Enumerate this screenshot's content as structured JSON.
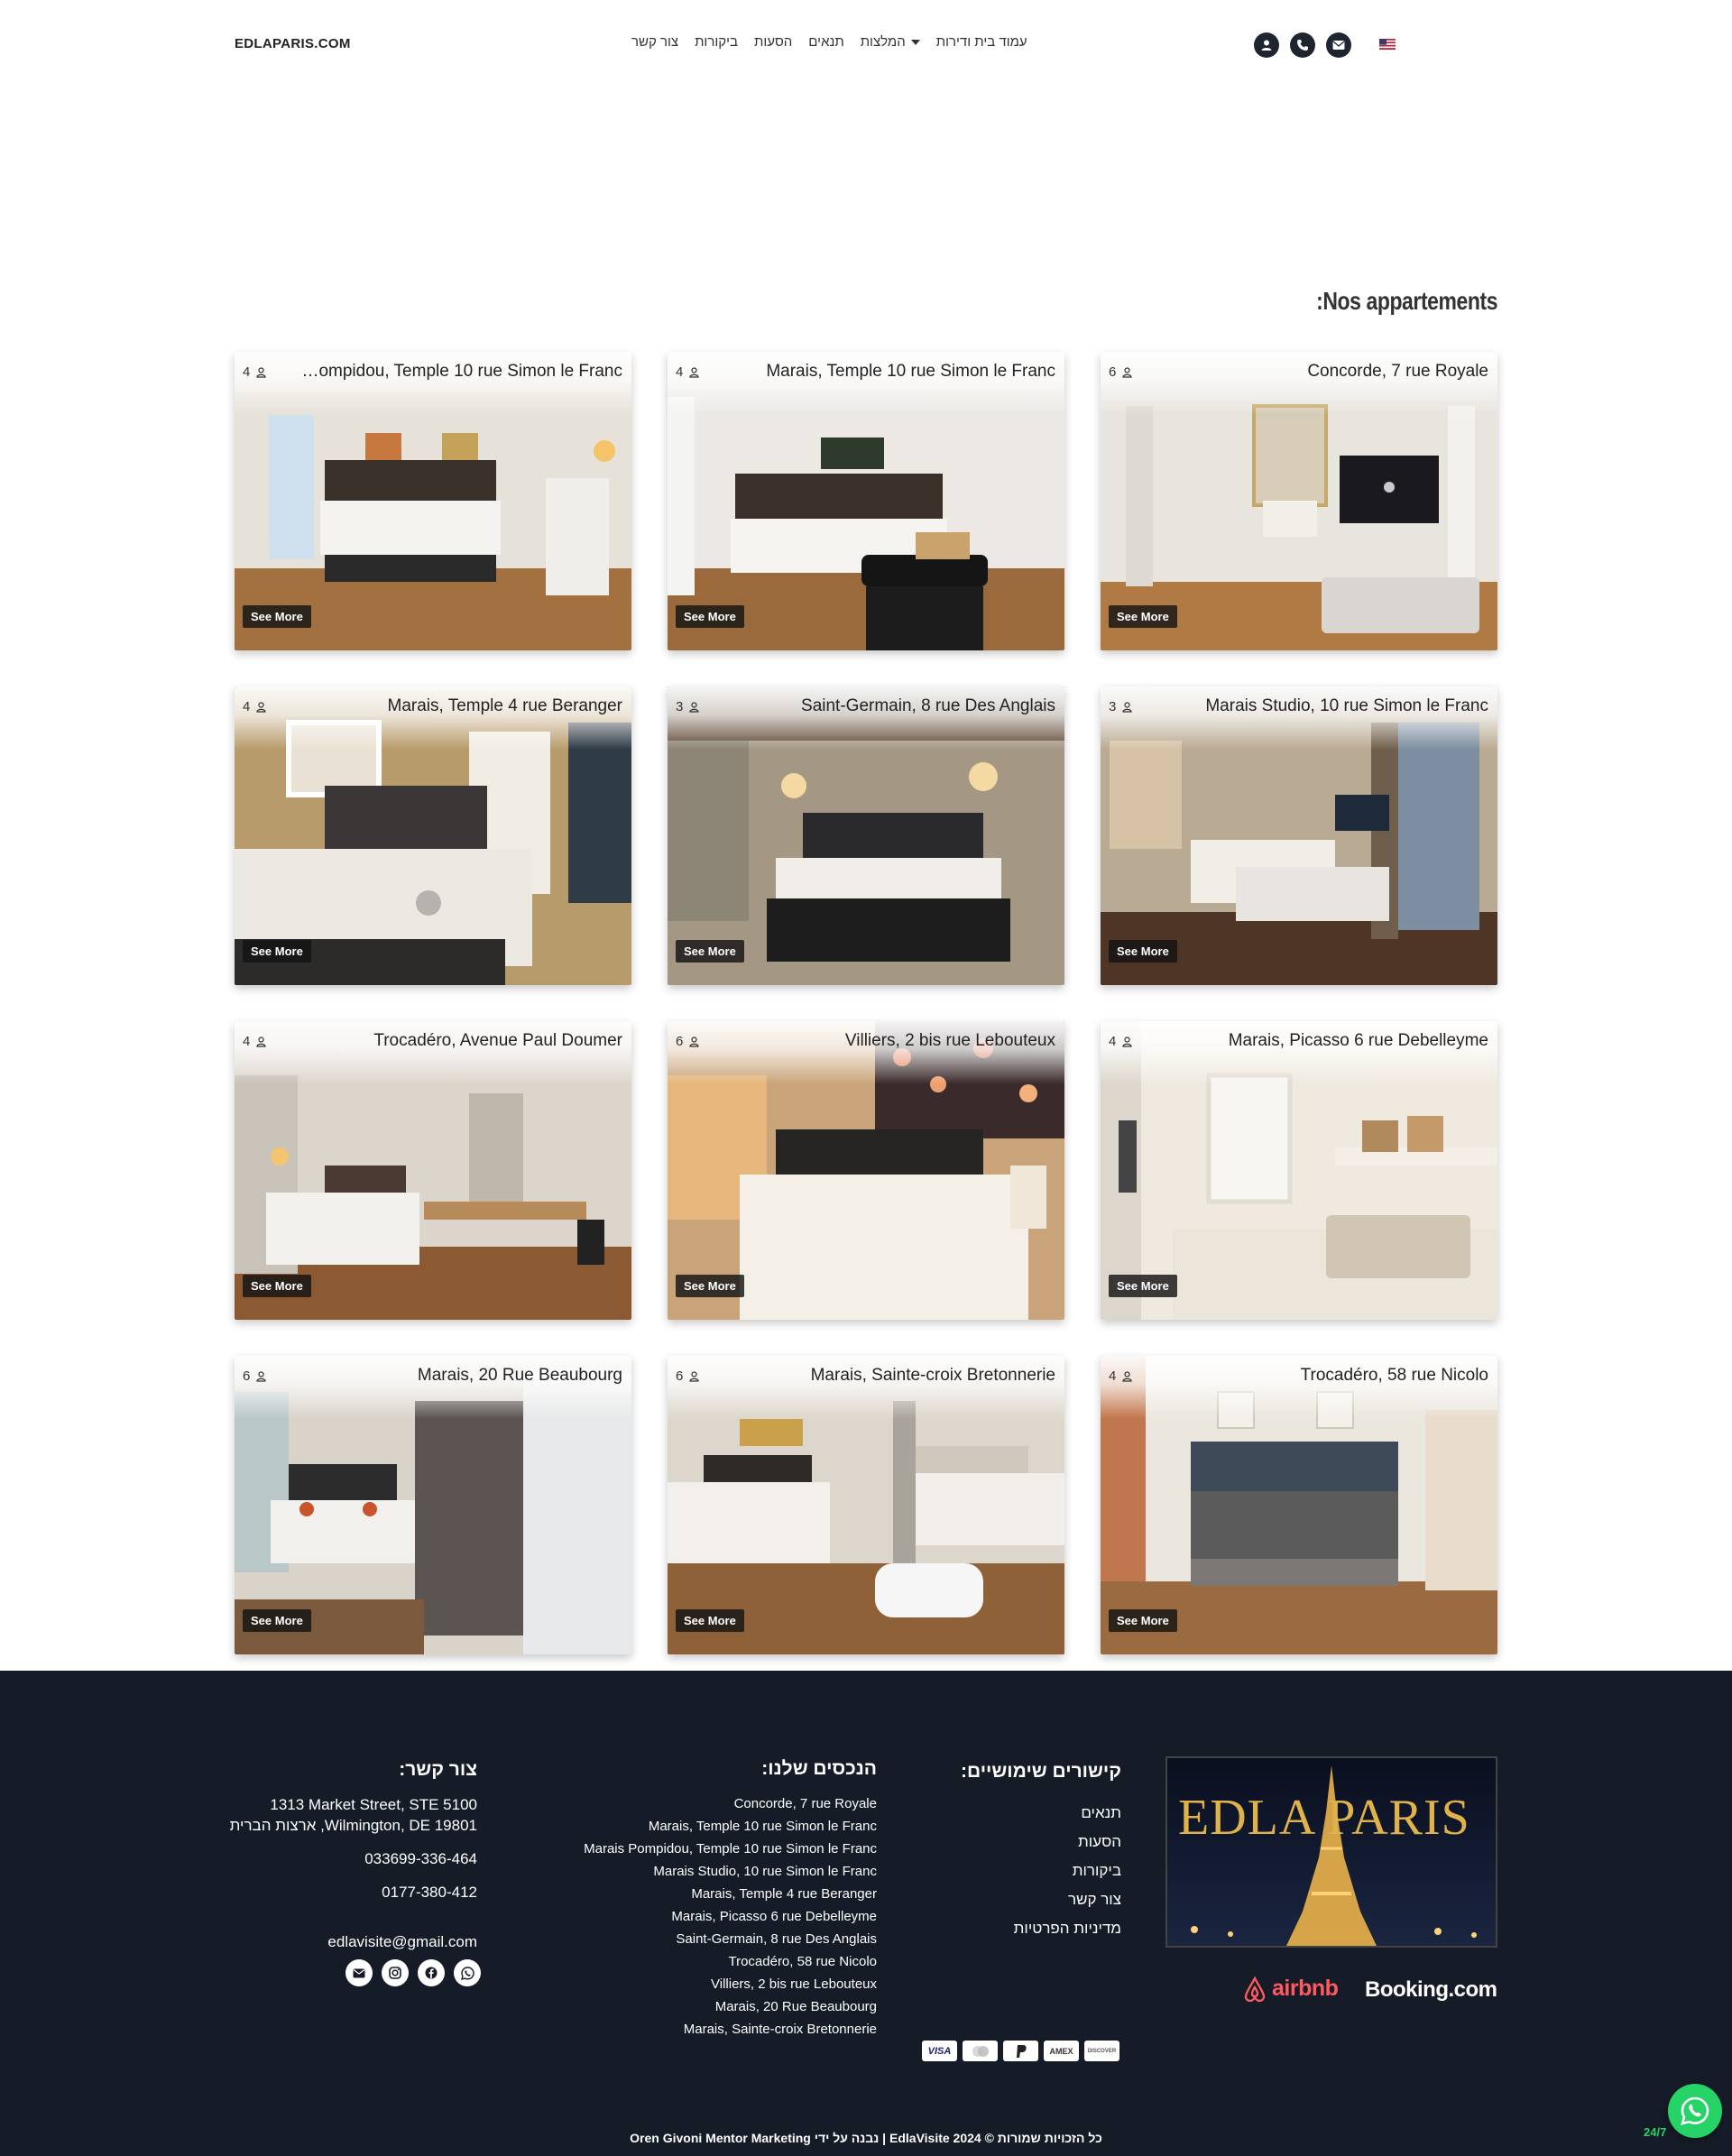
{
  "header": {
    "brand": "EDLAPARIS.COM",
    "nav": [
      {
        "label": "עמוד בית ודירות"
      },
      {
        "label": "המלצות"
      },
      {
        "label": "תנאים"
      },
      {
        "label": "הסעות"
      },
      {
        "label": "ביקורות"
      },
      {
        "label": "צור קשר"
      }
    ],
    "icons": [
      "user-icon",
      "phone-icon",
      "envelope-icon"
    ],
    "language_flag": "us-flag-icon"
  },
  "section": {
    "title": ":Nos appartements"
  },
  "apartments": [
    {
      "title": "Concorde, 7 rue Royale",
      "capacity": "6",
      "button": "See More"
    },
    {
      "title": "Marais, Temple 10 rue Simon le Franc",
      "capacity": "4",
      "button": "See More"
    },
    {
      "title": "Marais Pompidou, Temple 10 rue Simon le Franc",
      "capacity": "4",
      "button": "See More"
    },
    {
      "title": "Marais Studio, 10 rue Simon le Franc",
      "capacity": "3",
      "button": "See More"
    },
    {
      "title": "Saint-Germain, 8 rue Des Anglais",
      "capacity": "3",
      "button": "See More"
    },
    {
      "title": "Marais, Temple 4 rue Beranger",
      "capacity": "4",
      "button": "See More"
    },
    {
      "title": "Marais, Picasso 6 rue Debelleyme",
      "capacity": "4",
      "button": "See More"
    },
    {
      "title": "Villiers, 2 bis rue Lebouteux",
      "capacity": "6",
      "button": "See More"
    },
    {
      "title": "Trocadéro, Avenue Paul Doumer",
      "capacity": "4",
      "button": "See More"
    },
    {
      "title": "Trocadéro, 58 rue Nicolo",
      "capacity": "4",
      "button": "See More"
    },
    {
      "title": "Marais, Sainte-croix Bretonnerie",
      "capacity": "6",
      "button": "See More"
    },
    {
      "title": "Marais, 20 Rue Beaubourg",
      "capacity": "6",
      "button": "See More"
    }
  ],
  "footer": {
    "logo_text": "EDLA PARIS",
    "links_title": "קישורים שימושיים:",
    "links": [
      "תנאים",
      "הסעות",
      "ביקורות",
      "צור קשר",
      "מדיניות הפרטיות"
    ],
    "properties_title": "הנכסים שלנו:",
    "properties": [
      "Concorde, 7 rue Royale",
      "Marais, Temple 10 rue Simon le Franc",
      "Marais Pompidou, Temple 10 rue Simon le Franc",
      "Marais Studio, 10 rue Simon le Franc",
      "Marais, Temple 4 rue Beranger",
      "Marais, Picasso 6 rue Debelleyme",
      "Saint-Germain, 8 rue Des Anglais",
      "Trocadéro, 58 rue Nicolo",
      "Villiers, 2 bis rue Lebouteux",
      "Marais, 20 Rue Beaubourg",
      "Marais, Sainte-croix Bretonnerie"
    ],
    "contact_title": "צור קשר:",
    "address_line1": "1313 Market Street, STE 5100",
    "address_line2": "Wilmington, DE 19801, ארצות הברית",
    "phone1": "033699-336-464",
    "phone2": "0177-380-412",
    "email": "edlavisite@gmail.com",
    "partners": {
      "airbnb": "airbnb",
      "booking": "Booking.com"
    },
    "payment_methods": [
      "VISA",
      "MC",
      "PayPal",
      "AMEX",
      "DISCOVER"
    ],
    "social_icons": [
      "whatsapp-icon",
      "facebook-icon",
      "instagram-icon",
      "envelope-icon"
    ],
    "copyright": "כל הזכויות שמורות © EdlaVisite 2024 | נבנה על ידי Oren Givoni Mentor Marketing"
  },
  "whatsapp": {
    "label": "24/7"
  }
}
